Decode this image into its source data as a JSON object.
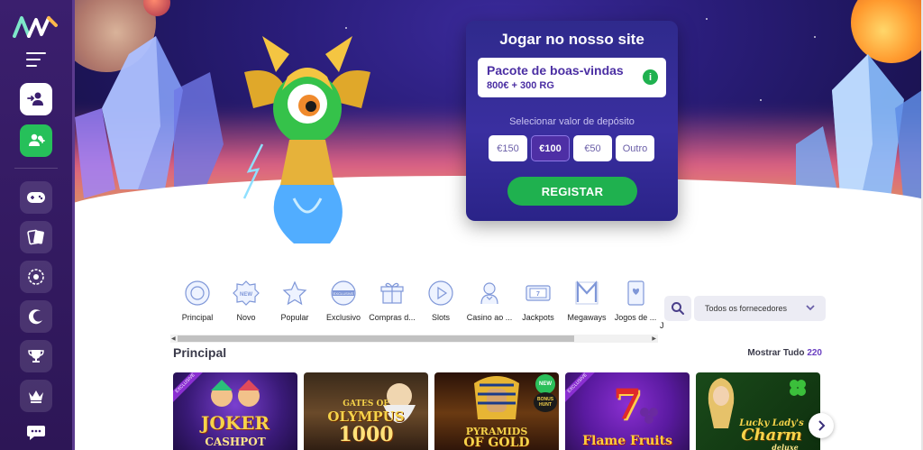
{
  "brand": {
    "logo_name": "mr-logo",
    "colors": {
      "primary": "#3b1f6e",
      "accent_green": "#26c05a",
      "accent_purple": "#6a3fc1"
    }
  },
  "sidebar": {
    "icons": [
      "menu-icon",
      "login-icon",
      "register-icon",
      "gamepad-icon",
      "cards-icon",
      "roulette-icon",
      "moon-icon",
      "trophy-icon",
      "crown-icon",
      "chat-icon"
    ]
  },
  "registration": {
    "title": "Jogar no nosso site",
    "offer_name": "Pacote de boas-vindas",
    "offer_amount": "800€ + 300 RG",
    "info": "i",
    "deposit_label": "Selecionar valor de depósito",
    "amounts": [
      "€150",
      "€100",
      "€50",
      "Outro"
    ],
    "selected_amount": "€100",
    "register_label": "REGISTAR"
  },
  "categories": {
    "items": [
      "Principal",
      "Novo",
      "Popular",
      "Exclusivo",
      "Compras d...",
      "Slots",
      "Casino ao ...",
      "Jackpots",
      "Megaways",
      "Jogos de ..."
    ],
    "more": "J",
    "new_badge": "NEW",
    "exclusive_badge": "EXCLUSIVE",
    "jackpot_glyph": "7"
  },
  "filters": {
    "providers_label": "Todos os fornecedores"
  },
  "section": {
    "title": "Principal",
    "show_all_label": "Mostrar Tudo",
    "count": "220"
  },
  "games": [
    {
      "title": "JOKER\nCASHPOT",
      "line1": "JOKER",
      "line2": "CASHPOT",
      "ribbon": "EXCLUSIVE"
    },
    {
      "title": "GATES OF OLYMPUS 1000",
      "line1": "GATES OF",
      "line2": "OLYMPUS",
      "line3": "1000"
    },
    {
      "title": "PYRAMIDS OF GOLD",
      "line1": "PYRAMIDS",
      "line2": "OF GOLD",
      "badge": "NEW",
      "badge2": "BONUS HUNT"
    },
    {
      "title": "Flame Fruits FRENZY",
      "line1": "7",
      "line2": "Flame Fruits",
      "ribbon": "EXCLUSIVE"
    },
    {
      "title": "Lucky Lady's Charm deluxe",
      "line1": "Lucky Lady's",
      "line2": "Charm",
      "line3": "deluxe"
    }
  ]
}
